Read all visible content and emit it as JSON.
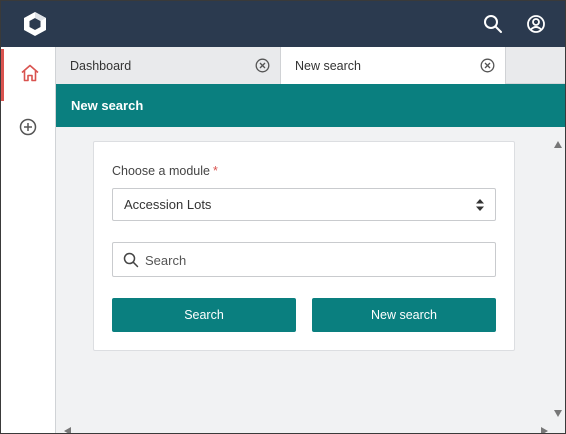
{
  "topbar": {
    "logo_icon": "hexagon-logo-icon",
    "search_icon": "search-icon",
    "user_icon": "user-account-icon"
  },
  "sidebar": {
    "items": [
      {
        "icon": "home-icon",
        "active": true
      },
      {
        "icon": "plus-circle-icon",
        "active": false
      }
    ]
  },
  "tabs": [
    {
      "label": "Dashboard",
      "active": false
    },
    {
      "label": "New search",
      "active": true
    }
  ],
  "panel": {
    "title": "New search"
  },
  "form": {
    "module_label": "Choose a module",
    "required_marker": "*",
    "module_value": "Accession Lots",
    "search_placeholder": "Search",
    "search_value": "",
    "search_button": "Search",
    "new_search_button": "New search"
  },
  "colors": {
    "topbar": "#2b3a4f",
    "accent": "#0a7f7f",
    "active_indicator": "#d9534f",
    "required": "#d9534f"
  }
}
